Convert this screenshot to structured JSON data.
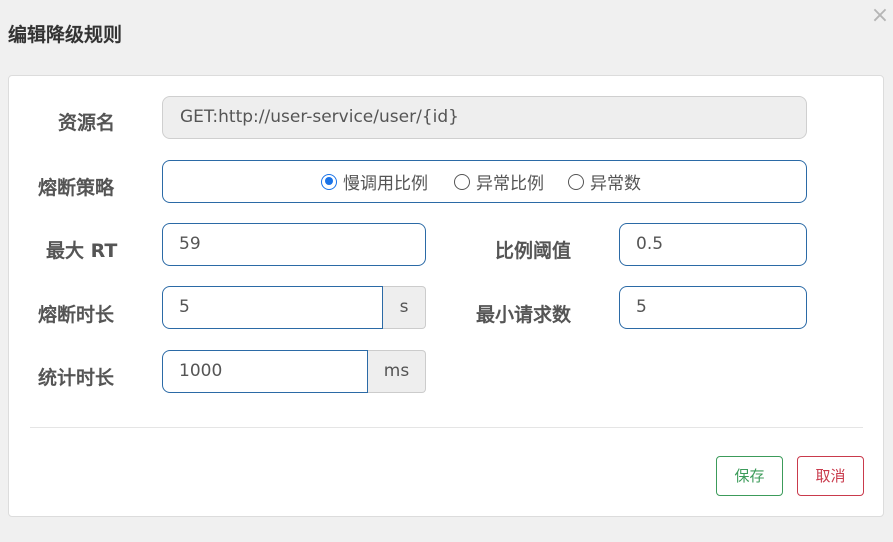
{
  "dialog": {
    "title": "编辑降级规则",
    "close_icon": "×"
  },
  "form": {
    "resource": {
      "label": "资源名",
      "value": "GET:http://user-service/user/{id}"
    },
    "strategy": {
      "label": "熔断策略",
      "options": [
        {
          "label": "慢调用比例",
          "checked": true
        },
        {
          "label": "异常比例",
          "checked": false
        },
        {
          "label": "异常数",
          "checked": false
        }
      ]
    },
    "max_rt": {
      "label": "最大 RT",
      "value": "59"
    },
    "ratio_threshold": {
      "label": "比例阈值",
      "value": "0.5"
    },
    "break_duration": {
      "label": "熔断时长",
      "value": "5",
      "unit": "s"
    },
    "min_requests": {
      "label": "最小请求数",
      "value": "5"
    },
    "stat_duration": {
      "label": "统计时长",
      "value": "1000",
      "unit": "ms"
    }
  },
  "actions": {
    "save_label": "保存",
    "cancel_label": "取消"
  },
  "colors": {
    "save": "#3c9b5a",
    "cancel": "#c93a4c",
    "input_border": "#2b6aa6",
    "radio_checked": "#1a73e8"
  }
}
